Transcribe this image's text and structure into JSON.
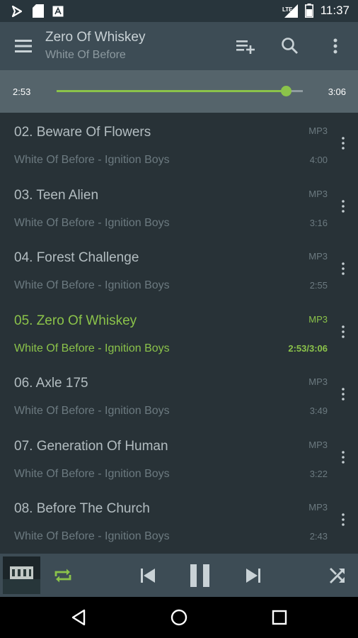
{
  "status_bar": {
    "time": "11:37",
    "network_label": "LTE",
    "icons": [
      "play-store-notification-icon",
      "sd-card-icon",
      "app-notification-icon",
      "lte-signal-icon",
      "battery-icon"
    ]
  },
  "toolbar": {
    "title": "Zero Of Whiskey",
    "subtitle": "White Of Before",
    "icons": [
      "menu-icon",
      "add-to-playlist-icon",
      "search-icon",
      "more-vert-icon"
    ]
  },
  "seekbar": {
    "current_time": "2:53",
    "total_time": "3:06",
    "progress": 0.93,
    "accent_color": "#8bc34a"
  },
  "tracks": [
    {
      "title": "02. Beware Of Flowers",
      "subtitle": "White Of Before - Ignition Boys",
      "format": "MP3",
      "duration": "4:00"
    },
    {
      "title": "03. Teen Alien",
      "subtitle": "White Of Before - Ignition Boys",
      "format": "MP3",
      "duration": "3:16"
    },
    {
      "title": "04. Forest Challenge",
      "subtitle": "White Of Before - Ignition Boys",
      "format": "MP3",
      "duration": "2:55"
    },
    {
      "title": "05. Zero Of Whiskey",
      "subtitle": "White Of Before - Ignition Boys",
      "format": "MP3",
      "duration": "2:53/3:06",
      "active": true
    },
    {
      "title": "06. Axle 175",
      "subtitle": "White Of Before - Ignition Boys",
      "format": "MP3",
      "duration": "3:49"
    },
    {
      "title": "07. Generation Of Human",
      "subtitle": "White Of Before - Ignition Boys",
      "format": "MP3",
      "duration": "3:22"
    },
    {
      "title": "08. Before The Church",
      "subtitle": "White Of Before - Ignition Boys",
      "format": "MP3",
      "duration": "2:43"
    }
  ],
  "player": {
    "icons": [
      "album-art",
      "repeat-icon",
      "skip-previous-icon",
      "pause-icon",
      "skip-next-icon",
      "shuffle-icon"
    ],
    "repeat_active_color": "#8bc34a"
  },
  "nav_bar": {
    "icons": [
      "back-icon",
      "home-icon",
      "recents-icon"
    ]
  }
}
